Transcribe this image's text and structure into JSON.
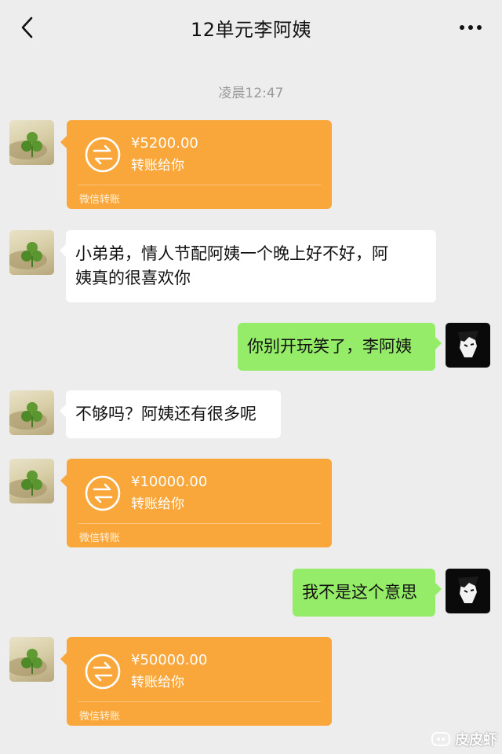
{
  "header": {
    "title": "12单元李阿姨",
    "back_icon": "chevron-left-icon",
    "more_icon": "more-dots-icon"
  },
  "timestamp": "凌晨12:47",
  "colors": {
    "background": "#ededed",
    "transfer_orange": "#f9a63a",
    "outgoing_green": "#95ec69",
    "incoming_white": "#ffffff"
  },
  "messages": [
    {
      "type": "transfer",
      "direction": "in",
      "amount": "¥5200.00",
      "note": "转账给你",
      "footer": "微信转账"
    },
    {
      "type": "text",
      "direction": "in",
      "lines": [
        "小弟弟，情人节配阿姨一个晚上好不好，阿",
        "姨真的很喜欢你"
      ]
    },
    {
      "type": "text",
      "direction": "out",
      "text": "你别开玩笑了，李阿姨"
    },
    {
      "type": "text",
      "direction": "in",
      "text": "不够吗？阿姨还有很多呢"
    },
    {
      "type": "transfer",
      "direction": "in",
      "amount": "¥10000.00",
      "note": "转账给你",
      "footer": "微信转账"
    },
    {
      "type": "text",
      "direction": "out",
      "text": "我不是这个意思"
    },
    {
      "type": "transfer",
      "direction": "in",
      "amount": "¥50000.00",
      "note": "转账给你",
      "footer": "微信转账"
    }
  ],
  "watermark": "皮皮虾"
}
